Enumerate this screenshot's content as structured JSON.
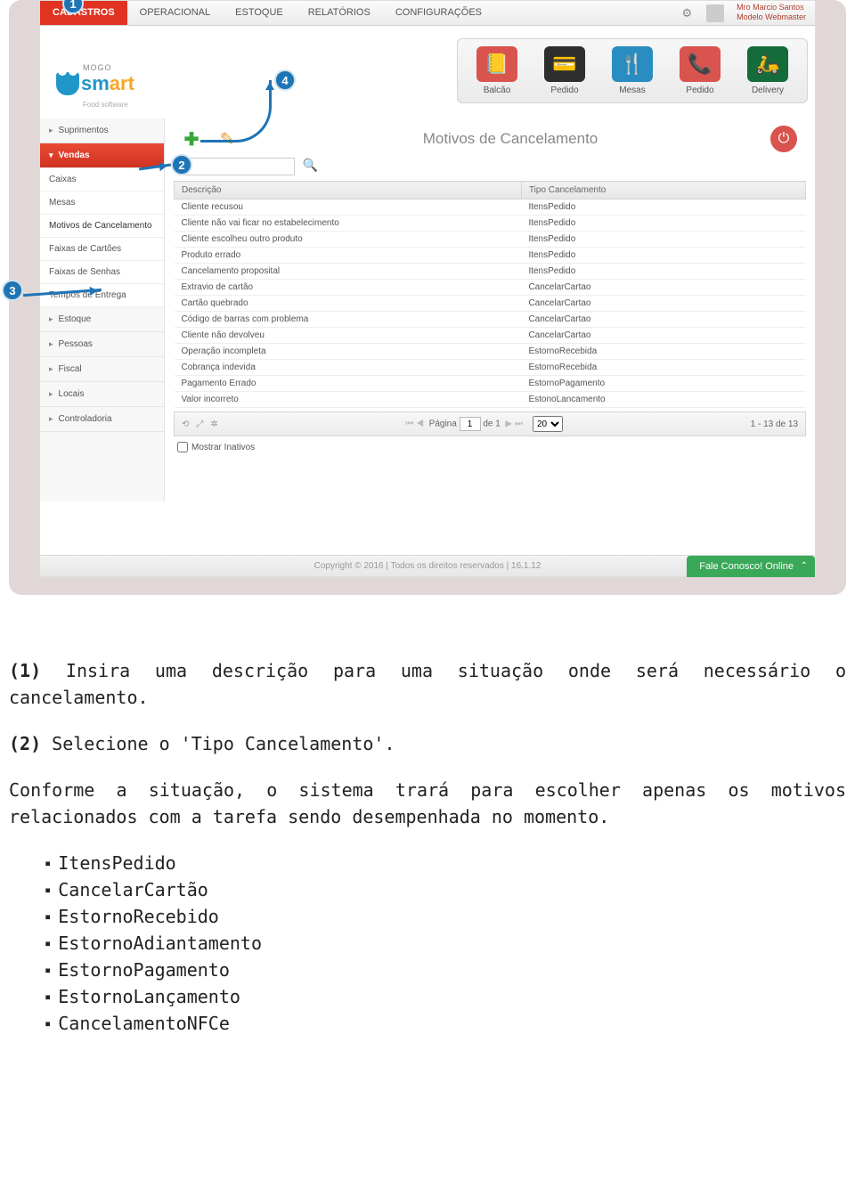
{
  "topnav": {
    "items": [
      "CADASTROS",
      "OPERACIONAL",
      "ESTOQUE",
      "RELATÓRIOS",
      "CONFIGURAÇÕES"
    ],
    "active_index": 0
  },
  "user": {
    "name": "Mro Marcio Santos",
    "role": "Modelo Webmaster"
  },
  "logo": {
    "top": "MOGO",
    "main_a": "sm",
    "main_b": "art",
    "sub": "Food software"
  },
  "quick_modules": [
    {
      "label": "Balcão"
    },
    {
      "label": "Pedido"
    },
    {
      "label": "Mesas"
    },
    {
      "label": "Pedido"
    },
    {
      "label": "Delivery"
    }
  ],
  "sidebar": {
    "groups": [
      "Suprimentos",
      "Vendas",
      "Estoque",
      "Pessoas",
      "Fiscal",
      "Locais",
      "Controladoria"
    ],
    "active_index": 1,
    "vendas_sub": [
      "Caixas",
      "Mesas",
      "Motivos de Cancelamento",
      "Faixas de Cartões",
      "Faixas de Senhas",
      "Tempos de Entrega"
    ],
    "vendas_sub_selected": 2
  },
  "content": {
    "title": "Motivos de Cancelamento",
    "search_placeholder": "",
    "columns": [
      "Descrição",
      "Tipo Cancelamento"
    ],
    "rows": [
      {
        "d": "Cliente recusou",
        "t": "ItensPedido"
      },
      {
        "d": "Cliente não vai ficar no estabelecimento",
        "t": "ItensPedido"
      },
      {
        "d": "Cliente escolheu outro produto",
        "t": "ItensPedido"
      },
      {
        "d": "Produto errado",
        "t": "ItensPedido"
      },
      {
        "d": "Cancelamento proposital",
        "t": "ItensPedido"
      },
      {
        "d": "Extravio de cartão",
        "t": "CancelarCartao"
      },
      {
        "d": "Cartão quebrado",
        "t": "CancelarCartao"
      },
      {
        "d": "Código de barras com problema",
        "t": "CancelarCartao"
      },
      {
        "d": "Cliente não devolveu",
        "t": "CancelarCartao"
      },
      {
        "d": "Operação incompleta",
        "t": "EstornoRecebida"
      },
      {
        "d": "Cobrança indevida",
        "t": "EstornoRecebida"
      },
      {
        "d": "Pagamento Errado",
        "t": "EstornoPagamento"
      },
      {
        "d": "Valor incorreto",
        "t": "EstonoLancamento"
      }
    ],
    "pager": {
      "page_label_a": "Página",
      "page_current": "1",
      "page_label_b": "de 1",
      "page_size": "20",
      "range": "1 - 13 de 13"
    },
    "show_inactive": "Mostrar Inativos"
  },
  "footer": "Copyright © 2016  |  Todos os direitos reservados  |  16.1.12",
  "chat": "Fale Conosco! Online",
  "badges": {
    "1": "1",
    "2": "2",
    "3": "3",
    "4": "4"
  },
  "doc": {
    "p1_lead": "(1)",
    "p1": " Insira uma descrição para uma situação onde será necessário o cancelamento.",
    "p2_lead": "(2)",
    "p2": " Selecione o 'Tipo Cancelamento'.",
    "p3": "Conforme a situação, o sistema trará para escolher apenas os motivos relacionados com a tarefa sendo desempenhada no momento.",
    "bullets": [
      "ItensPedido",
      "CancelarCartão",
      "EstornoRecebido",
      "EstornoAdiantamento",
      "EstornoPagamento",
      "EstornoLançamento",
      "CancelamentoNFCe"
    ]
  }
}
